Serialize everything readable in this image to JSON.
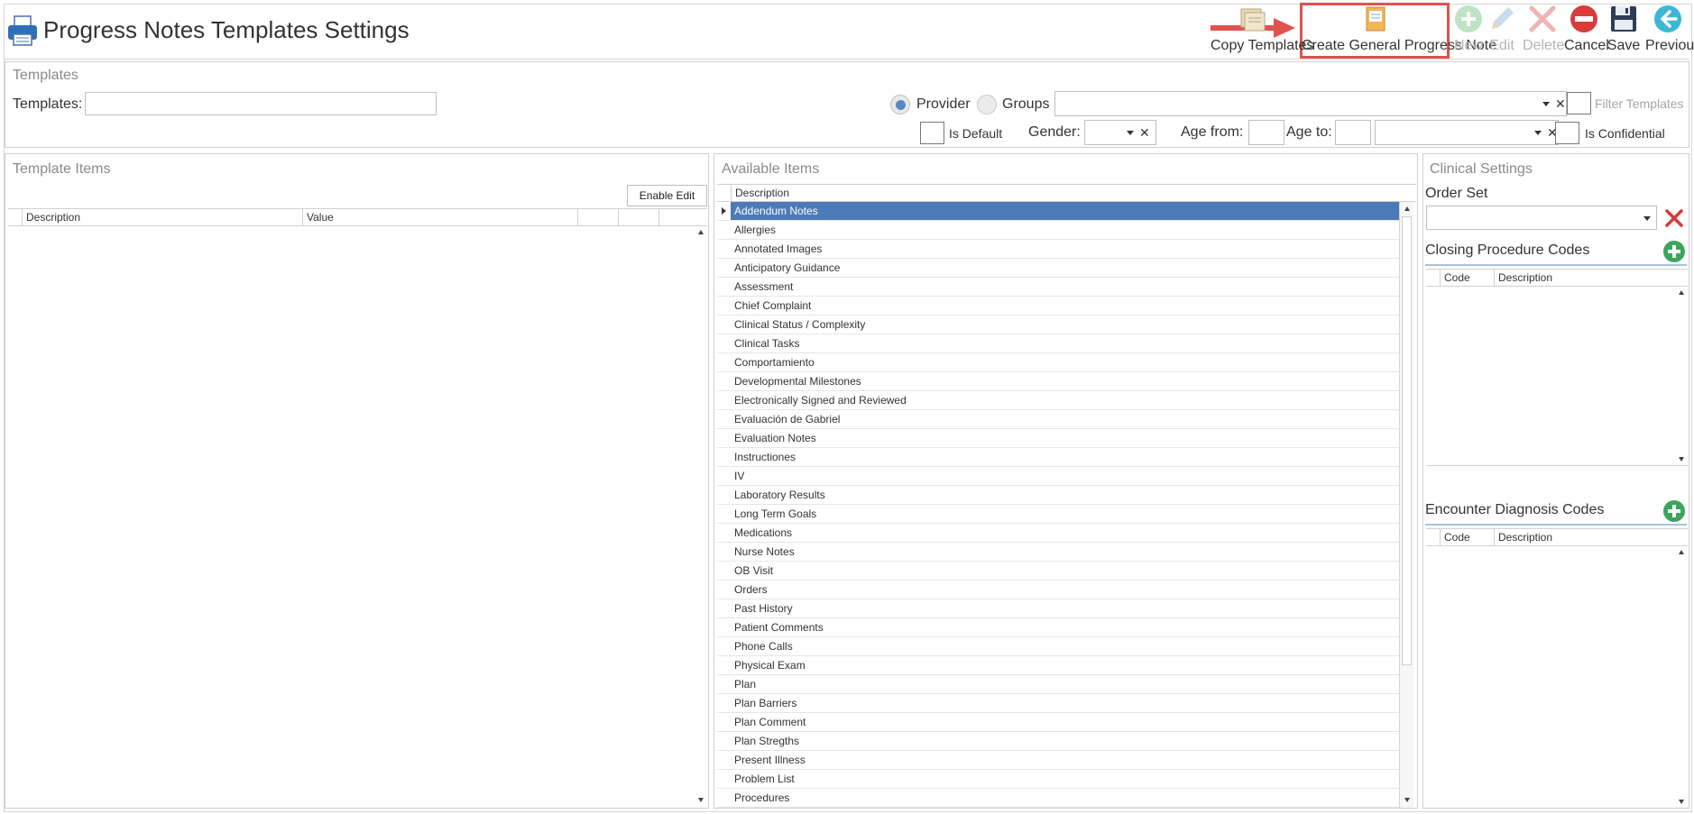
{
  "header": {
    "title": "Progress Notes Templates Settings"
  },
  "toolbar": {
    "copy_templates": "Copy Templates",
    "create_general": "Create General Progress Note",
    "new": "New",
    "edit": "Edit",
    "delete": "Delete",
    "cancel": "Cancel",
    "save": "Save",
    "previous": "Previous"
  },
  "templates_panel": {
    "title": "Templates",
    "templates_label": "Templates:",
    "templates_value": "",
    "provider_label": "Provider",
    "groups_label": "Groups",
    "filter_templates_label": "Filter Templates",
    "is_default_label": "Is Default",
    "gender_label": "Gender:",
    "age_from_label": "Age from:",
    "age_to_label": "Age to:",
    "is_confidential_label": "Is Confidential"
  },
  "template_items": {
    "title": "Template Items",
    "enable_edit": "Enable Edit",
    "columns": [
      "Description",
      "Value"
    ]
  },
  "available_items": {
    "title": "Available Items",
    "column": "Description",
    "selected_index": 0,
    "rows": [
      "Addendum Notes",
      "Allergies",
      "Annotated Images",
      "Anticipatory Guidance",
      "Assessment",
      "Chief Complaint",
      "Clinical Status / Complexity",
      "Clinical Tasks",
      "Comportamiento",
      "Developmental Milestones",
      "Electronically Signed and Reviewed",
      "Evaluación de Gabriel",
      "Evaluation Notes",
      "Instructiones",
      "IV",
      "Laboratory Results",
      "Long Term Goals",
      "Medications",
      "Nurse Notes",
      "OB Visit",
      "Orders",
      "Past History",
      "Patient Comments",
      "Phone Calls",
      "Physical Exam",
      "Plan",
      "Plan Barriers",
      "Plan Comment",
      "Plan Stregths",
      "Present Illness",
      "Problem List",
      "Procedures"
    ]
  },
  "clinical_settings": {
    "title": "Clinical Settings",
    "order_set_label": "Order Set",
    "closing_codes_title": "Closing Procedure Codes",
    "encounter_codes_title": "Encounter Diagnosis Codes",
    "code_col": "Code",
    "desc_col": "Description"
  }
}
